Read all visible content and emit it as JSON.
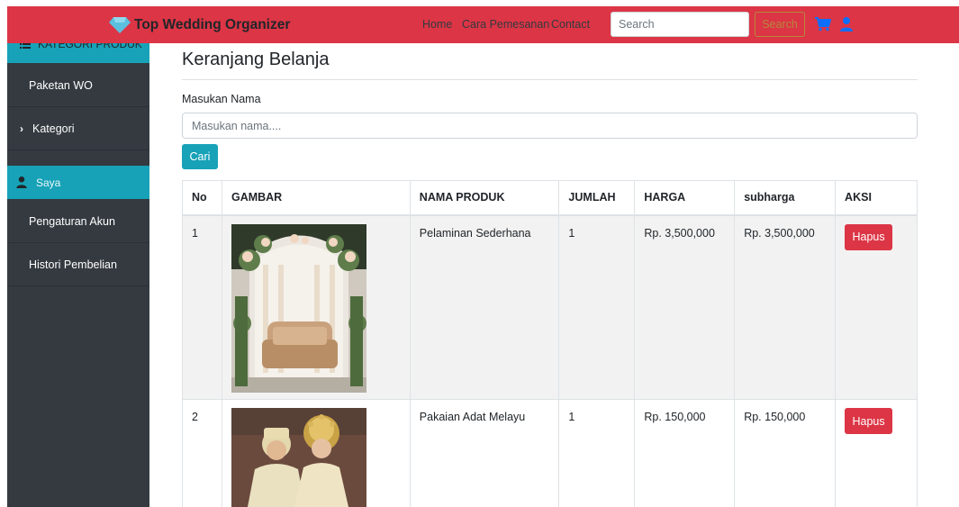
{
  "navbar": {
    "brand": "Top Wedding Organizer",
    "links": [
      "Home",
      "Cara Pemesanan",
      "Contact"
    ],
    "search_placeholder": "Search",
    "search_button": "Search",
    "icons": [
      "diamond-icon",
      "cart-icon",
      "user-icon"
    ]
  },
  "sidebar": {
    "header": "KATEGORI PRODUK",
    "items": [
      {
        "label": "Paketan WO"
      },
      {
        "label": "Kategori"
      },
      {
        "label": "Saya"
      },
      {
        "label": "Pengaturan Akun"
      },
      {
        "label": "Histori Pembelian"
      }
    ]
  },
  "main": {
    "title": "Keranjang Belanja",
    "name_label": "Masukan Nama",
    "name_placeholder": "Masukan nama....",
    "search_button": "Cari"
  },
  "table": {
    "headers": [
      "No",
      "GAMBAR",
      "NAMA PRODUK",
      "JUMLAH",
      "HARGA",
      "subharga",
      "AKSI"
    ],
    "rows": [
      {
        "no": "1",
        "image": "wedding-stage-image",
        "name": "Pelaminan Sederhana",
        "qty": "1",
        "price": "Rp. 3,500,000",
        "subtotal": "Rp. 3,500,000",
        "action": "Hapus"
      },
      {
        "no": "2",
        "image": "malay-wedding-attire-image",
        "name": "Pakaian Adat Melayu",
        "qty": "1",
        "price": "Rp. 150,000",
        "subtotal": "Rp. 150,000",
        "action": "Hapus"
      }
    ]
  },
  "colors": {
    "navbar": "#dc3545",
    "sidebar": "#343a40",
    "sidebar_active": "#17a2b8",
    "button_info": "#17a2b8",
    "button_danger": "#dc3545",
    "search_outline": "#b8863c",
    "icon_blue": "#0d6efd",
    "diamond": "#5bc0de"
  }
}
